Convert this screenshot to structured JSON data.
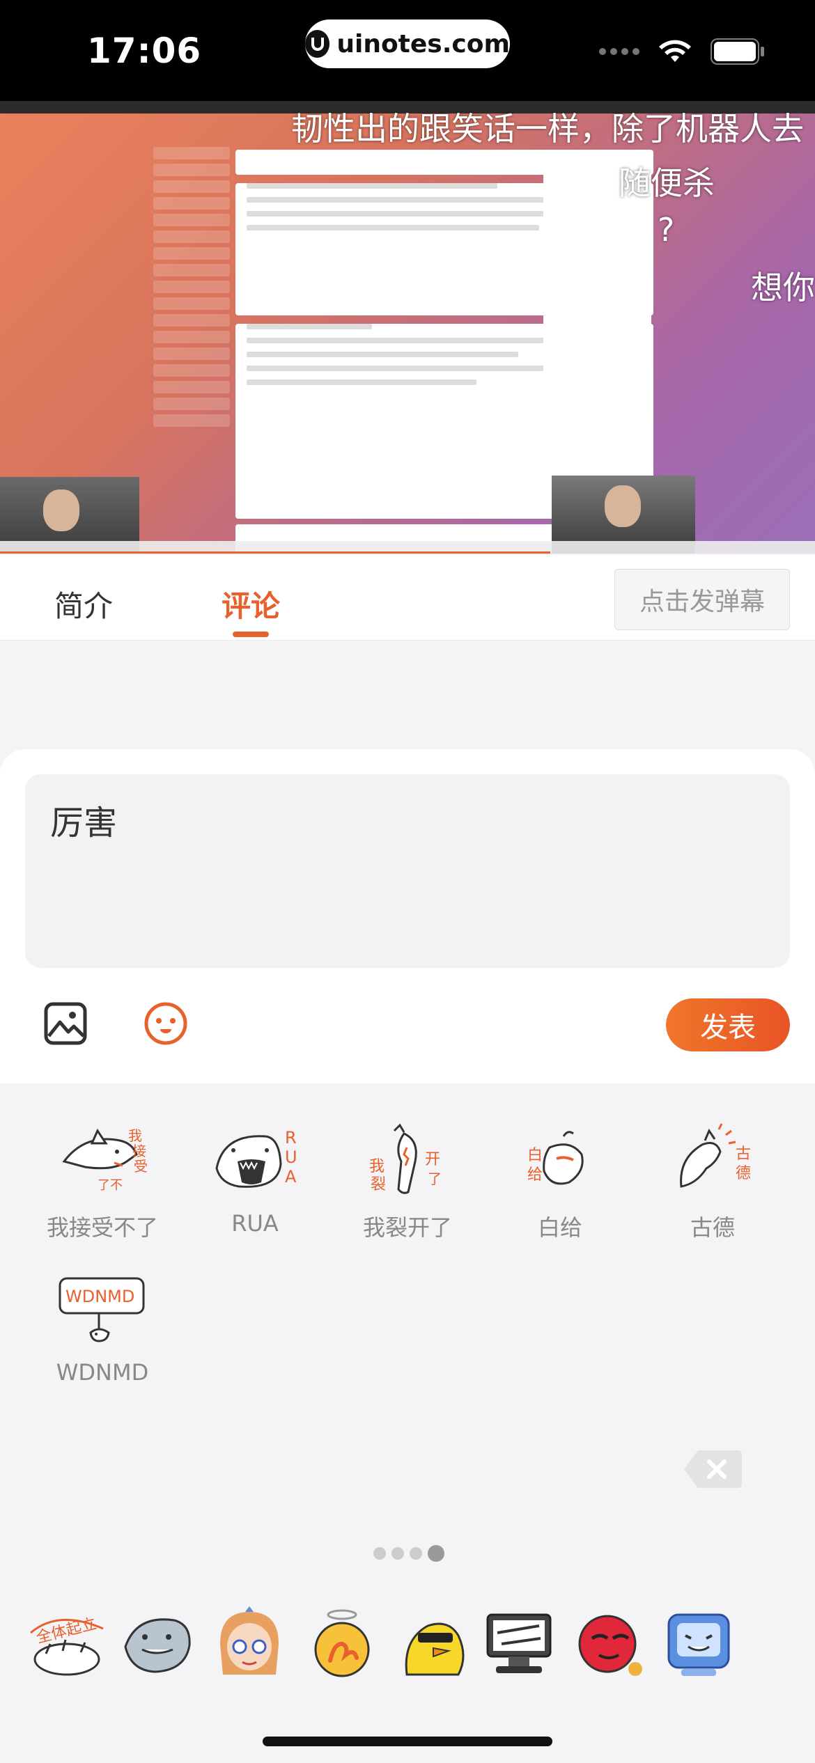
{
  "status_bar": {
    "time": "17:06",
    "url": "uinotes.com"
  },
  "video": {
    "danmaku": [
      "韧性出的跟笑话一样，除了机器人去",
      "随便杀",
      "?",
      "想你"
    ]
  },
  "tabs": [
    {
      "label": "简介",
      "active": false
    },
    {
      "label": "评论",
      "active": true
    }
  ],
  "danmu_button": "点击发弹幕",
  "comment": {
    "text": "厉害",
    "send_label": "发表"
  },
  "stickers": [
    {
      "label": "我接受不了",
      "icon": "shark-cant-accept-sticker"
    },
    {
      "label": "RUA",
      "icon": "shark-rua-sticker"
    },
    {
      "label": "我裂开了",
      "icon": "shark-crack-sticker"
    },
    {
      "label": "白给",
      "icon": "shark-free-sticker"
    },
    {
      "label": "古德",
      "icon": "shark-good-sticker"
    },
    {
      "label": "WDNMD",
      "icon": "shark-wdnmd-sticker"
    }
  ],
  "sticker_pages": {
    "count": 4,
    "current": 4
  },
  "sticker_packs": [
    "all-up-pack",
    "shark-pack",
    "girl-pack",
    "halo-pack",
    "duck-pack",
    "computer-pack",
    "red-ball-pack",
    "tv-pack"
  ],
  "colors": {
    "accent": "#e8612c",
    "panel": "#ffffff",
    "background": "#f4f4f6"
  }
}
